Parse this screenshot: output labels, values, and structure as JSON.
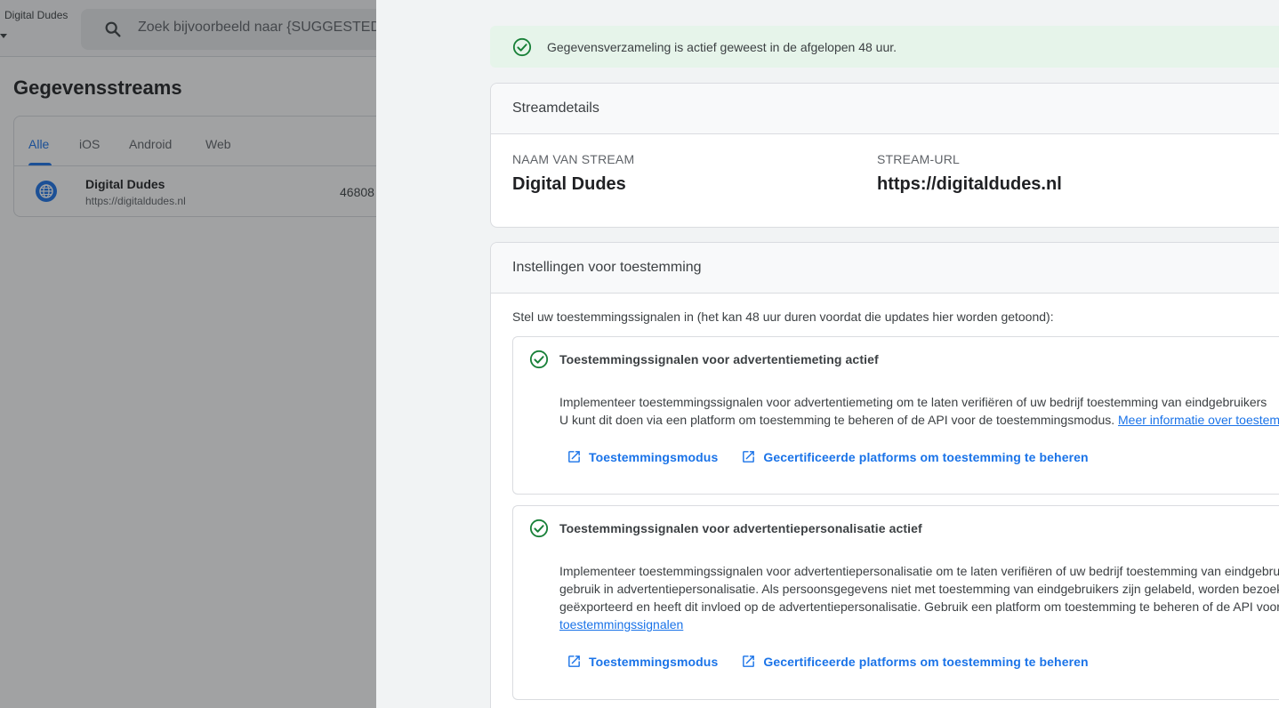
{
  "background": {
    "account": "Digital Dudes",
    "search_placeholder": "Zoek bijvoorbeeld naar {SUGGESTED",
    "page_title": "Gegevensstreams",
    "tabs": [
      "Alle",
      "iOS",
      "Android",
      "Web"
    ],
    "active_tab": "Alle",
    "stream_row": {
      "name": "Digital Dudes",
      "url": "https://digitaldudes.nl",
      "id": "46808"
    }
  },
  "panel": {
    "banner": "Gegevensverzameling is actief geweest in de afgelopen 48 uur.",
    "details": {
      "title": "Streamdetails",
      "name_label": "NAAM VAN STREAM",
      "name_value": "Digital Dudes",
      "url_label": "STREAM-URL",
      "url_value": "https://digitaldudes.nl"
    },
    "consent": {
      "title": "Instellingen voor toestemming",
      "intro": "Stel uw toestemmingssignalen in (het kan 48 uur duren voordat die updates hier worden getoond):",
      "measurement": {
        "title": "Toestemmingssignalen voor advertentiemeting actief",
        "line1": "Implementeer toestemmingssignalen voor advertentiemeting om te laten verifiëren of uw bedrijf toestemming van eindgebruikers",
        "line2": "U kunt dit doen via een platform om toestemming te beheren of de API voor de toestemmingsmodus. ",
        "line2_link": "Meer informatie over toestemming",
        "action1": "Toestemmingsmodus",
        "action2": "Gecertificeerde platforms om toestemming te beheren"
      },
      "personalization": {
        "title": "Toestemmingssignalen voor advertentiepersonalisatie actief",
        "line1": "Implementeer toestemmingssignalen voor advertentiepersonalisatie om te laten verifiëren of uw bedrijf toestemming van eindgebruikers",
        "line2": "gebruik in advertentiepersonalisatie. Als persoonsgegevens niet met toestemming van eindgebruikers zijn gelabeld, worden bezoekers",
        "line3": "geëxporteerd en heeft dit invloed op de advertentiepersonalisatie. Gebruik een platform om toestemming te beheren of de API voor",
        "line4_link": "toestemmingssignalen",
        "action1": "Toestemmingsmodus",
        "action2": "Gecertificeerde platforms om toestemming te beheren"
      }
    }
  },
  "colors": {
    "accent": "#1a73e8",
    "success": "#188038",
    "banner_bg": "#e6f4ea"
  },
  "icons": {
    "search": "search-icon",
    "globe": "globe-icon",
    "check": "check-circle-icon",
    "external": "open-in-new-icon"
  }
}
